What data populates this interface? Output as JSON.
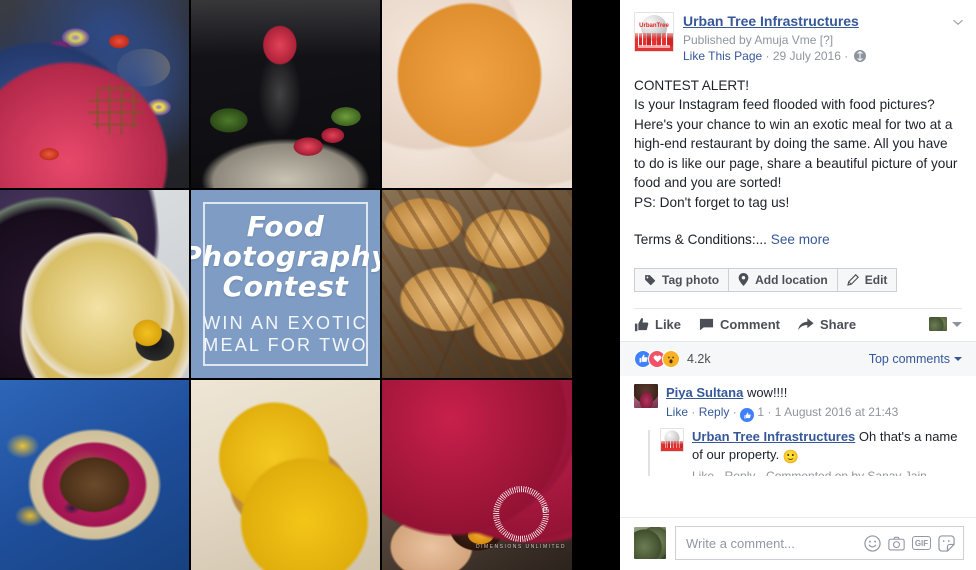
{
  "post": {
    "page_name": "Urban Tree Infrastructures",
    "published_by": "Published by Amuja Vme [?]",
    "like_this_page": "Like This Page",
    "date": "29 July 2016",
    "sep": "·",
    "privacy_icon": "globe-icon",
    "body": "CONTEST ALERT!\nIs your Instagram feed flooded with food pictures? Here's your chance to win an exotic meal for two at a high-end restaurant by doing the same. All you have to do is like our page, share a beautiful picture of your food and you are sorted!\nPS: Don't forget to tag us!",
    "terms_label": "Terms & Conditions:...",
    "see_more": "See more",
    "chevron_icon": "chevron-down-icon"
  },
  "photo_actions": [
    {
      "label": "Tag photo",
      "icon": "tag-icon"
    },
    {
      "label": "Add location",
      "icon": "location-pin-icon"
    },
    {
      "label": "Edit",
      "icon": "pencil-icon"
    }
  ],
  "engagement": {
    "like": "Like",
    "comment": "Comment",
    "share": "Share",
    "like_icon": "thumbs-up-icon",
    "comment_icon": "speech-bubble-icon",
    "share_icon": "arrow-share-icon",
    "audience_icon": "audience-thumbnail",
    "audience_caret": "caret-down-icon"
  },
  "reactions": {
    "items": [
      {
        "name": "like-reaction",
        "glyph": "👍",
        "color": "#4080ff"
      },
      {
        "name": "love-reaction",
        "glyph": "♥",
        "color": "#f25268"
      },
      {
        "name": "wow-reaction",
        "glyph": "😮",
        "color": "#f7b125"
      }
    ],
    "count": "4.2k",
    "sort_label": "Top comments"
  },
  "comments": [
    {
      "author": "Piya Sultana",
      "text": "wow!!!!",
      "like": "Like",
      "reply": "Reply",
      "sep": "·",
      "like_count": "1",
      "timestamp": "1 August 2016 at 21:43",
      "avatar": "piya-avatar",
      "is_reply": false
    },
    {
      "author": "Urban Tree Infrastructures",
      "text": " Oh that's a name of our property. ",
      "emoji": "🙂",
      "meta_clipped": "Like · Reply · Commented on by Sanay Jain",
      "avatar": "page-avatar",
      "is_reply": true
    }
  ],
  "composer": {
    "placeholder": "Write a comment...",
    "value": "",
    "avatar": "user-avatar",
    "icons": [
      {
        "name": "emoji-icon",
        "label": ""
      },
      {
        "name": "camera-icon",
        "label": ""
      },
      {
        "name": "gif-icon",
        "label": "GIF"
      },
      {
        "name": "sticker-icon",
        "label": ""
      }
    ]
  },
  "photo_grid": {
    "contest_card": {
      "title_line1": "Food",
      "title_line2": "Photography",
      "title_line3": "Contest",
      "sub_line1": "WIN AN EXOTIC",
      "sub_line2": "MEAL FOR TWO",
      "bg_color": "#7e9cc4"
    },
    "watermark": {
      "brand": "UrbanTree",
      "tagline": "DIMENSIONS UNLIMITED"
    },
    "tiles": [
      {
        "name": "photo-tile-waffles-flowers",
        "alt": "Heart waffles with edible flowers and berries on dark plate"
      },
      {
        "name": "photo-tile-watermelon-granita",
        "alt": "Watermelon granita in a glass with melon slices"
      },
      {
        "name": "photo-tile-powdered-donut-holes",
        "alt": "Powdered sugar donut holes with orange filling"
      },
      {
        "name": "photo-tile-fruit-toast-flatlay",
        "alt": "Flatlay of fruit toasts, figs, berries and mango"
      },
      {
        "name": "photo-tile-contest-card",
        "alt": "Food Photography Contest card"
      },
      {
        "name": "photo-tile-grilled-sandwiches",
        "alt": "Grilled panini sandwiches stacked"
      },
      {
        "name": "photo-tile-blueberry-crumble",
        "alt": "Blueberry crumble pie on blue cloth"
      },
      {
        "name": "photo-tile-egg-toast",
        "alt": "Fried eggs on toast"
      },
      {
        "name": "photo-tile-chocolate-cupcakes",
        "alt": "Chocolate cupcakes with raspberries and brownie in hand"
      }
    ]
  }
}
